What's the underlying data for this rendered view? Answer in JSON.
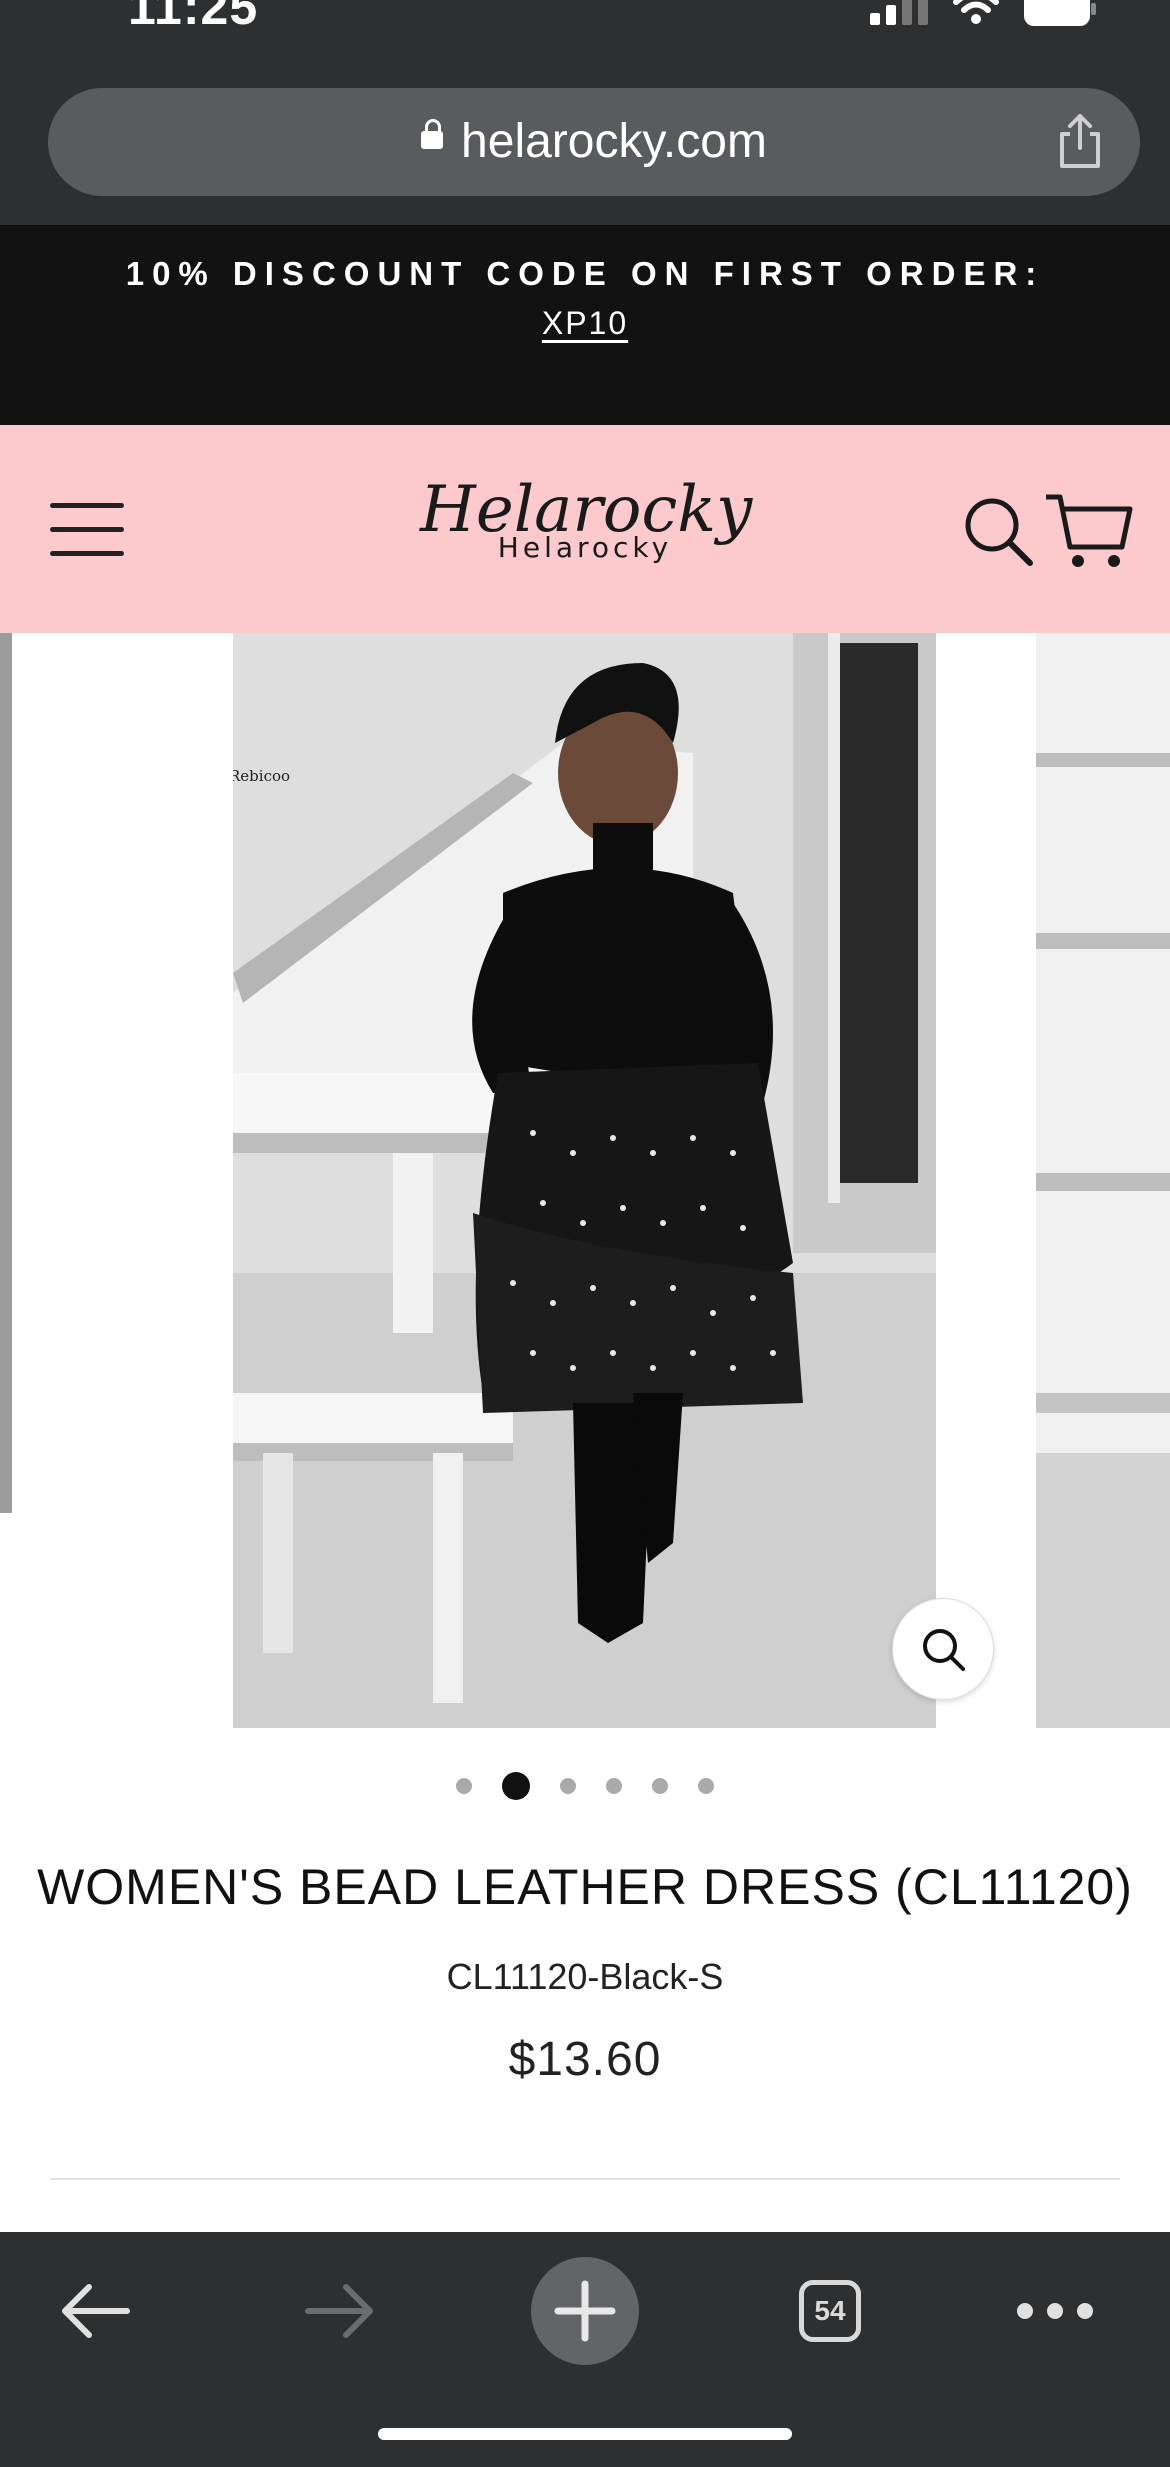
{
  "status_bar": {
    "time": "11:25"
  },
  "browser": {
    "url": "helarocky.com"
  },
  "promo": {
    "text": "10% DISCOUNT CODE ON FIRST ORDER:",
    "code": "XP10"
  },
  "header": {
    "logo_script": "Helarocky",
    "logo_text": "Helarocky"
  },
  "gallery": {
    "watermark": "Rebicoo",
    "slide_count": 6,
    "active_slide": 2
  },
  "product": {
    "title": "WOMEN'S BEAD LEATHER DRESS (CL11120)",
    "sku": "CL11120-Black-S",
    "price": "$13.60"
  },
  "toolbar": {
    "tab_count": "54"
  },
  "colors": {
    "header_bg": "#fcc9cd",
    "promo_bg": "#121212",
    "browser_chrome": "#2e2f31"
  },
  "icons": [
    "lock-icon",
    "share-icon",
    "menu-icon",
    "search-icon",
    "cart-icon",
    "zoom-icon",
    "back-arrow-icon",
    "forward-arrow-icon",
    "plus-icon",
    "more-dots-icon"
  ]
}
